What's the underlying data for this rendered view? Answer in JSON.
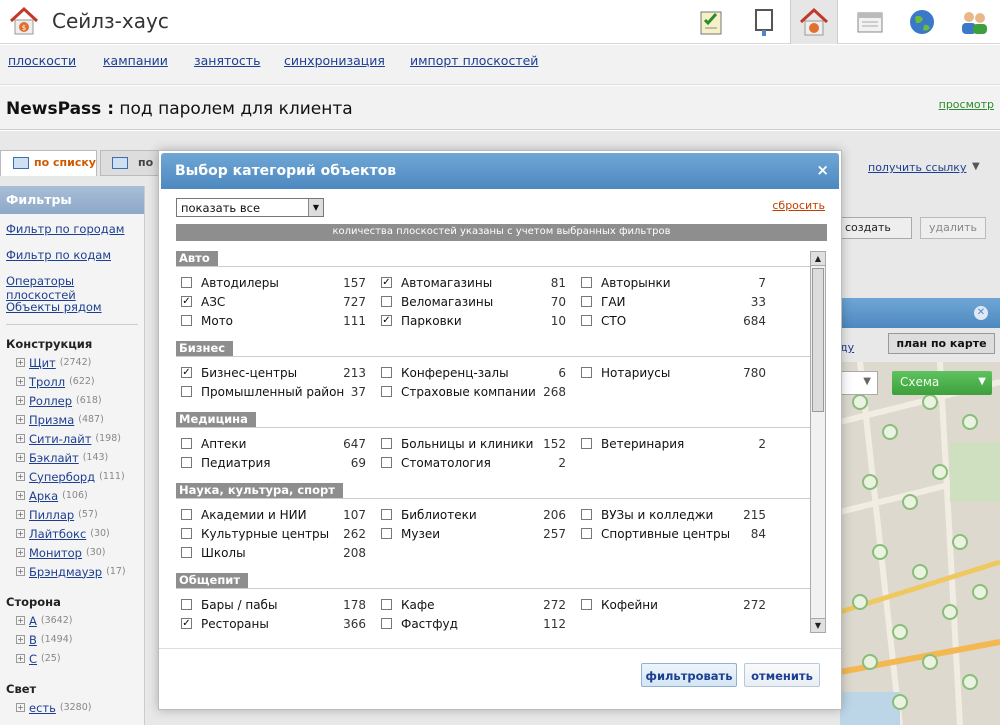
{
  "app": {
    "title": "Сейлз-хаус"
  },
  "nav": [
    "плоскости",
    "кампании",
    "занятость",
    "синхронизация",
    "импорт плоскостей"
  ],
  "page": {
    "title_bold": "NewsPass :",
    "title_rest": " под паролем для клиента",
    "preview": "просмотр"
  },
  "tabs": {
    "list": "по списку",
    "map": "по"
  },
  "sidebar": {
    "header": "Фильтры",
    "links": [
      "Фильтр по городам",
      "Фильтр по кодам",
      "Операторы плоскостей",
      "Объекты рядом"
    ],
    "construction": {
      "title": "Конструкция",
      "items": [
        {
          "label": "Щит",
          "count": "(2742)"
        },
        {
          "label": "Тролл",
          "count": "(622)"
        },
        {
          "label": "Роллер",
          "count": "(618)"
        },
        {
          "label": "Призма",
          "count": "(487)"
        },
        {
          "label": "Сити-лайт",
          "count": "(198)"
        },
        {
          "label": "Бэклайт",
          "count": "(143)"
        },
        {
          "label": "Суперборд",
          "count": "(111)"
        },
        {
          "label": "Арка",
          "count": "(106)"
        },
        {
          "label": "Пиллар",
          "count": "(57)"
        },
        {
          "label": "Лайтбокс",
          "count": "(30)"
        },
        {
          "label": "Монитор",
          "count": "(30)"
        },
        {
          "label": "Брэндмауэр",
          "count": "(17)"
        }
      ]
    },
    "side": {
      "title": "Сторона",
      "items": [
        {
          "label": "А",
          "count": "(3642)"
        },
        {
          "label": "В",
          "count": "(1494)"
        },
        {
          "label": "С",
          "count": "(25)"
        }
      ]
    },
    "light": {
      "title": "Свет",
      "items": [
        {
          "label": "есть",
          "count": "(3280)"
        }
      ]
    }
  },
  "right_panel": {
    "get_link": "получить ссылку",
    "create": "создать",
    "delete": "удалить",
    "link_fragment": "ду",
    "plan_on_map": "план по карте",
    "scheme": "Схема"
  },
  "modal": {
    "title": "Выбор категорий объектов",
    "close": "×",
    "show_select": "показать все",
    "reset": "сбросить",
    "note": "количества плоскостей указаны с учетом выбранных фильтров",
    "filter_button": "фильтровать",
    "cancel_button": "отменить",
    "sections": [
      {
        "title": "Авто",
        "items": [
          {
            "label": "Автодилеры",
            "count": "157",
            "checked": false
          },
          {
            "label": "Автомагазины",
            "count": "81",
            "checked": true
          },
          {
            "label": "Авторынки",
            "count": "7",
            "checked": false
          },
          {
            "label": "АЗС",
            "count": "727",
            "checked": true
          },
          {
            "label": "Веломагазины",
            "count": "70",
            "checked": false
          },
          {
            "label": "ГАИ",
            "count": "33",
            "checked": false
          },
          {
            "label": "Мото",
            "count": "111",
            "checked": false
          },
          {
            "label": "Парковки",
            "count": "10",
            "checked": true
          },
          {
            "label": "СТО",
            "count": "684",
            "checked": false
          }
        ]
      },
      {
        "title": "Бизнес",
        "items": [
          {
            "label": "Бизнес-центры",
            "count": "213",
            "checked": true
          },
          {
            "label": "Конференц-залы",
            "count": "6",
            "checked": false
          },
          {
            "label": "Нотариусы",
            "count": "780",
            "checked": false
          },
          {
            "label": "Промышленный район",
            "count": "37",
            "checked": false
          },
          {
            "label": "Страховые компании",
            "count": "268",
            "checked": false
          }
        ]
      },
      {
        "title": "Медицина",
        "items": [
          {
            "label": "Аптеки",
            "count": "647",
            "checked": false
          },
          {
            "label": "Больницы и клиники",
            "count": "152",
            "checked": false
          },
          {
            "label": "Ветеринария",
            "count": "2",
            "checked": false
          },
          {
            "label": "Педиатрия",
            "count": "69",
            "checked": false
          },
          {
            "label": "Стоматология",
            "count": "2",
            "checked": false
          }
        ]
      },
      {
        "title": "Наука, культура, спорт",
        "items": [
          {
            "label": "Академии и НИИ",
            "count": "107",
            "checked": false
          },
          {
            "label": "Библиотеки",
            "count": "206",
            "checked": false
          },
          {
            "label": "ВУЗы и колледжи",
            "count": "215",
            "checked": false
          },
          {
            "label": "Культурные центры",
            "count": "262",
            "checked": false
          },
          {
            "label": "Музеи",
            "count": "257",
            "checked": false
          },
          {
            "label": "Спортивные центры",
            "count": "84",
            "checked": false
          },
          {
            "label": "Школы",
            "count": "208",
            "checked": false
          }
        ]
      },
      {
        "title": "Общепит",
        "items": [
          {
            "label": "Бары / пабы",
            "count": "178",
            "checked": false
          },
          {
            "label": "Кафе",
            "count": "272",
            "checked": false
          },
          {
            "label": "Кофейни",
            "count": "272",
            "checked": false
          },
          {
            "label": "Рестораны",
            "count": "366",
            "checked": true
          },
          {
            "label": "Фастфуд",
            "count": "112",
            "checked": false
          }
        ]
      }
    ]
  },
  "colors": {
    "accent": "#4d89c0",
    "link": "#1d3f91",
    "reset": "#c04000",
    "scheme": "#3da03d"
  }
}
